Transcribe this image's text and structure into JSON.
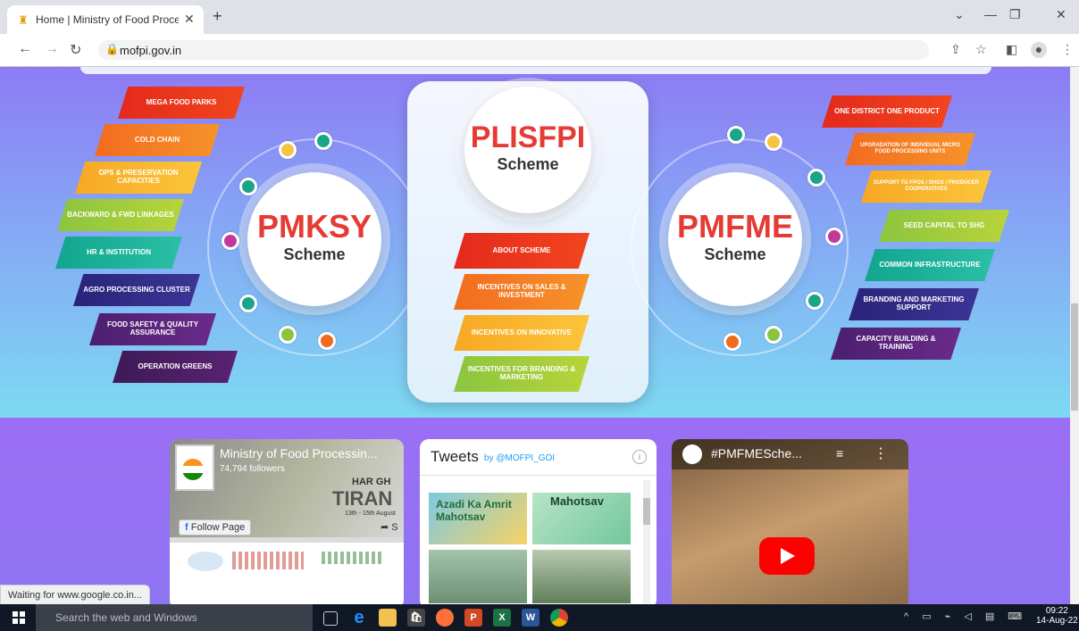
{
  "browser": {
    "tab_title": "Home | Ministry of Food Process",
    "url": "mofpi.gov.in",
    "status_text": "Waiting for www.google.co.in..."
  },
  "hero": {
    "pmksy": {
      "title": "PMKSY",
      "subtitle": "Scheme",
      "items": [
        "MEGA FOOD PARKS",
        "COLD CHAIN",
        "OPS & PRESERVATION CAPACITIES",
        "BACKWARD & FWD LINKAGES",
        "HR & INSTITUTION",
        "AGRO PROCESSING CLUSTER",
        "FOOD SAFETY & QUALITY ASSURANCE",
        "OPERATION GREENS"
      ]
    },
    "plisfpi": {
      "title": "PLISFPI",
      "subtitle": "Scheme",
      "items": [
        "ABOUT SCHEME",
        "INCENTIVES ON SALES & INVESTMENT",
        "INCENTIVES ON INNOVATIVE",
        "INCENTIVES FOR BRANDING & MARKETING"
      ]
    },
    "pmfme": {
      "title": "PMFME",
      "subtitle": "Scheme",
      "items": [
        "ONE DISTRICT ONE PRODUCT",
        "UPGRADATION OF INDIVIDUAL MICRO FOOD PROCESSING UNITS",
        "SUPPORT TO FPOS / SHGS / PRODUCER COOPERATIVES",
        "SEED CAPITAL TO SHG",
        "COMMON INFRASTRUCTURE",
        "BRANDING AND MARKETING SUPPORT",
        "CAPACITY BUILDING & TRAINING"
      ]
    }
  },
  "facebook": {
    "page_name": "Ministry of Food Processin...",
    "followers": "74,794 followers",
    "follow_label": "Follow Page",
    "banner_text": "HAR GH",
    "banner_text2": "TIRAN",
    "banner_date": "13th - 15th August",
    "share": "S"
  },
  "twitter": {
    "title": "Tweets",
    "by": "by @MOFPI_GOI",
    "img1_text": "Azadi Ka Amrit Mahotsav",
    "img2_text": "Mahotsav"
  },
  "youtube": {
    "title": "#PMFMESche..."
  },
  "taskbar": {
    "search_placeholder": "Search the web and Windows",
    "time": "09:22",
    "date": "14-Aug-22"
  },
  "colors": {
    "accent_red": "#e53b34"
  }
}
